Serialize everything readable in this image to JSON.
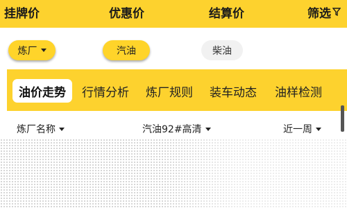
{
  "header": {
    "tabs": [
      {
        "label": "挂牌价"
      },
      {
        "label": "优惠价"
      },
      {
        "label": "结算价"
      },
      {
        "label": "筛选"
      }
    ],
    "filter_icon": "filter-icon"
  },
  "chips": [
    {
      "label": "炼厂",
      "dropdown": true,
      "style": "yellow"
    },
    {
      "label": "汽油",
      "dropdown": false,
      "style": "yellow"
    },
    {
      "label": "柴油",
      "dropdown": false,
      "style": "grey"
    }
  ],
  "category_tabs": [
    {
      "label": "油价走势",
      "active": true
    },
    {
      "label": "行情分析"
    },
    {
      "label": "炼厂规则"
    },
    {
      "label": "装车动态"
    },
    {
      "label": "油样检测"
    }
  ],
  "table_header": {
    "col1": "炼厂名称",
    "col2": "汽油92#高清",
    "col3": "近一周"
  },
  "colors": {
    "accent": "#fdd22e",
    "chip_yellow": "#ffd42a",
    "chip_grey": "#f1f1f1"
  }
}
